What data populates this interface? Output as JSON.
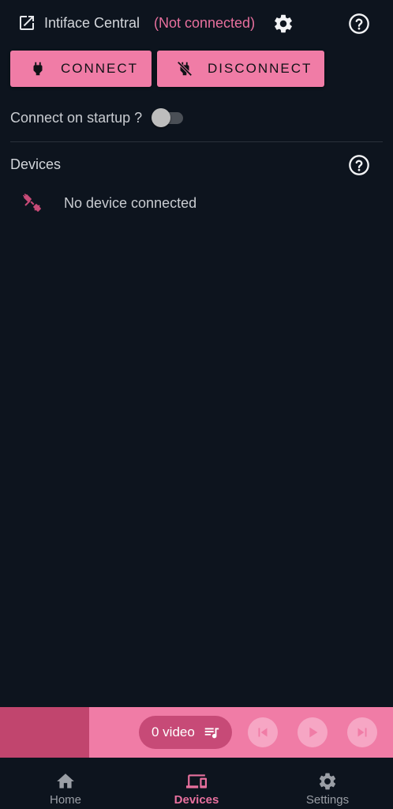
{
  "header": {
    "title": "Intiface Central",
    "status": "(Not connected)",
    "status_color": "#e8709e",
    "icons": [
      "open-in-new-icon",
      "gear-icon",
      "help-circle-icon"
    ]
  },
  "actions": {
    "connect_label": "CONNECT",
    "disconnect_label": "DISCONNECT",
    "button_color": "#f07ca6"
  },
  "startup": {
    "label": "Connect on startup ?",
    "enabled": false
  },
  "devices": {
    "title": "Devices",
    "empty_label": "No device connected"
  },
  "player": {
    "video_count_label": "0 video",
    "accent": "#c74a77"
  },
  "nav": {
    "items": [
      {
        "label": "Home",
        "icon": "home-icon",
        "active": false
      },
      {
        "label": "Devices",
        "icon": "devices-icon",
        "active": true
      },
      {
        "label": "Settings",
        "icon": "gear-icon",
        "active": false
      }
    ]
  }
}
